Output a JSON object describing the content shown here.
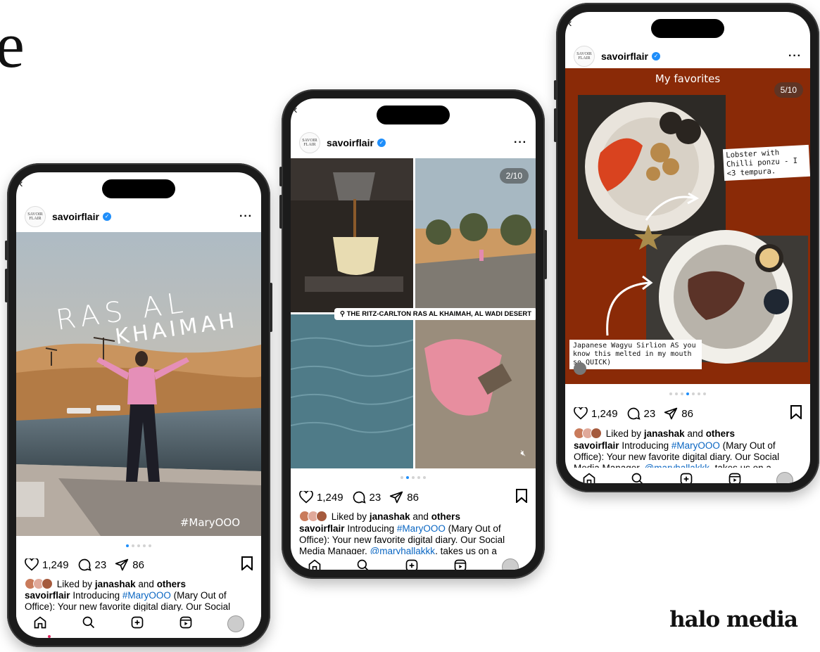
{
  "decor": {
    "corner_glyph": "e",
    "brand": "halo media"
  },
  "post": {
    "username": "savoirflair",
    "avatar_text": "SAVOIR FLAIR",
    "likes_count": "1,249",
    "comments_count": "23",
    "shares_count": "86",
    "liked_by_prefix": "Liked by",
    "liked_by_user": "janashak",
    "liked_by_and": "and",
    "liked_by_others": "others",
    "caption_user": "savoirflair",
    "caption_intro": "Introducing",
    "caption_hashtag": "#MaryOOO",
    "caption_mid": "(Mary Out of Office): Your new favorite digital diary. Our Social Media Manager,",
    "caption_mention": "@maryhallakkk",
    "caption_end": ", takes us on a dreamy"
  },
  "phone_left": {
    "overlay_title_line1": "RAS AL",
    "overlay_title_line2": "KHAIMAH",
    "overlay_hashtag": "#MaryOOO",
    "carousel_active": 1,
    "carousel_total": 5
  },
  "phone_middle": {
    "slide_counter": "2/10",
    "location": "THE RITZ-CARLTON RAS AL KHAIMAH, AL WADI DESERT",
    "carousel_active": 2,
    "carousel_total": 5
  },
  "phone_right": {
    "slide_title": "My favorites",
    "slide_counter": "5/10",
    "note_top": "Lobster with Chilli ponzu - I <3 tempura.",
    "note_bottom": "Japanese Wagyu Sirlion AS you know this melted in my mouth so QUICK)",
    "carousel_active": 4,
    "carousel_total": 7
  },
  "colors": {
    "accent": "#1f8efa",
    "link": "#0a66c2",
    "rust": "#8a2a07"
  }
}
